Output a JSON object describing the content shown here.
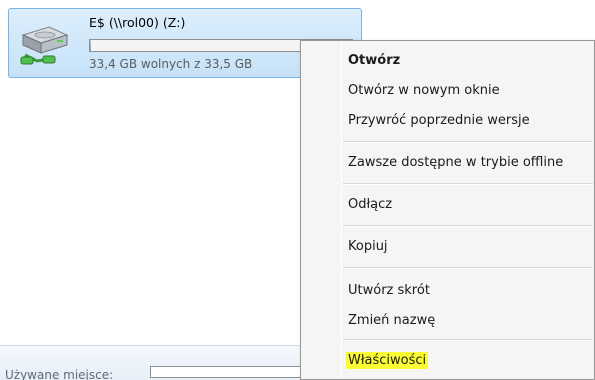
{
  "drive": {
    "name": "E$ (\\\\rol00) (Z:)",
    "free_text": "33,4 GB wolnych z 33,5 GB",
    "used_fraction": 0.003,
    "icon": "network-drive-icon"
  },
  "details": {
    "used_label": "Używane miejsce:"
  },
  "context_menu": {
    "items": [
      {
        "label": "Otwórz",
        "default": true
      },
      {
        "label": "Otwórz w nowym oknie"
      },
      {
        "label": "Przywróć poprzednie wersje"
      },
      {
        "label": "Zawsze dostępne w trybie offline"
      },
      {
        "label": "Odłącz"
      },
      {
        "label": "Kopiuj"
      },
      {
        "label": "Utwórz skrót"
      },
      {
        "label": "Zmień nazwę"
      },
      {
        "label": "Właściwości",
        "highlighted": true
      }
    ]
  },
  "colors": {
    "selection_bg": "#c6e2f8",
    "selection_border": "#7ab3e4",
    "highlight": "#fcfc35"
  }
}
